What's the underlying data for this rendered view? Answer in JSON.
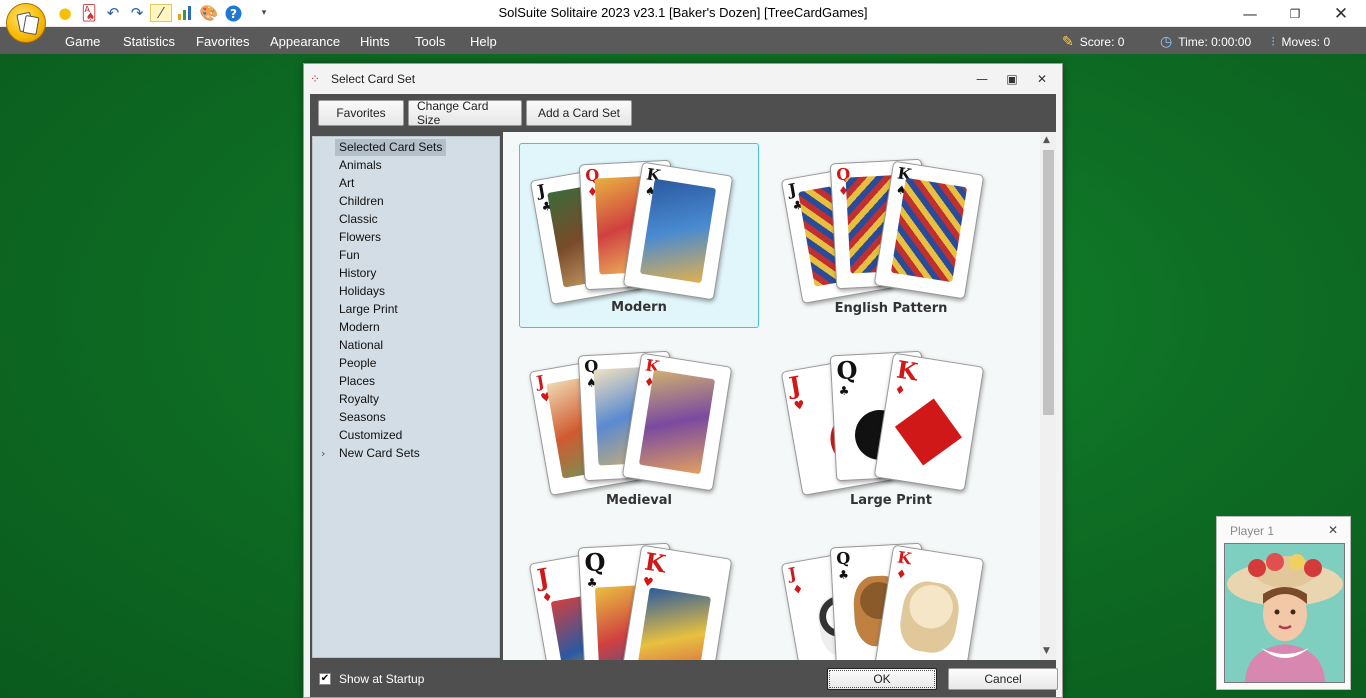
{
  "window": {
    "title": "SolSuite Solitaire 2023 v23.1  [Baker's Dozen]  [TreeCardGames]",
    "controls": [
      "minimize",
      "restore",
      "close"
    ]
  },
  "quick_access": [
    "new-game-icon",
    "cards-icon",
    "undo-icon",
    "redo-icon",
    "hint-wand-icon",
    "statistics-icon",
    "appearance-palette-icon",
    "help-icon",
    "dropdown-icon"
  ],
  "menu": {
    "items": [
      "Game",
      "Statistics",
      "Favorites",
      "Appearance",
      "Hints",
      "Tools",
      "Help"
    ]
  },
  "status": {
    "score": "Score: 0",
    "time": "Time:  0:00:00",
    "moves": "Moves: 0"
  },
  "dialog": {
    "title": "Select Card Set",
    "toolbar": [
      "Favorites",
      "Change Card Size",
      "Add a Card Set"
    ],
    "categories": [
      "Selected Card Sets",
      "Animals",
      "Art",
      "Children",
      "Classic",
      "Flowers",
      "Fun",
      "History",
      "Holidays",
      "Large Print",
      "Modern",
      "National",
      "People",
      "Places",
      "Royalty",
      "Seasons",
      "Customized",
      "New Card Sets"
    ],
    "selected_category": "Selected Card Sets",
    "card_sets": [
      {
        "name": "Modern",
        "selected": true
      },
      {
        "name": "English Pattern",
        "selected": false
      },
      {
        "name": "Medieval",
        "selected": false
      },
      {
        "name": "Large Print",
        "selected": false
      },
      {
        "name": "",
        "selected": false
      },
      {
        "name": "",
        "selected": false
      }
    ],
    "card_ranks": {
      "jack": "J",
      "queen": "Q",
      "king": "K"
    },
    "card_suits": {
      "club": "♣",
      "spade": "♠",
      "heart": "♥",
      "diamond": "♦"
    },
    "show_at_startup": {
      "label": "Show at Startup",
      "checked": true,
      "mark": "✔"
    },
    "ok_label": "OK",
    "cancel_label": "Cancel"
  },
  "player": {
    "name": "Player 1"
  },
  "colors": {
    "felt": "#0e6e24",
    "menubar": "#5a5a5a",
    "selection_border": "#49c3d2",
    "selection_fill": "#e0f6fa"
  }
}
